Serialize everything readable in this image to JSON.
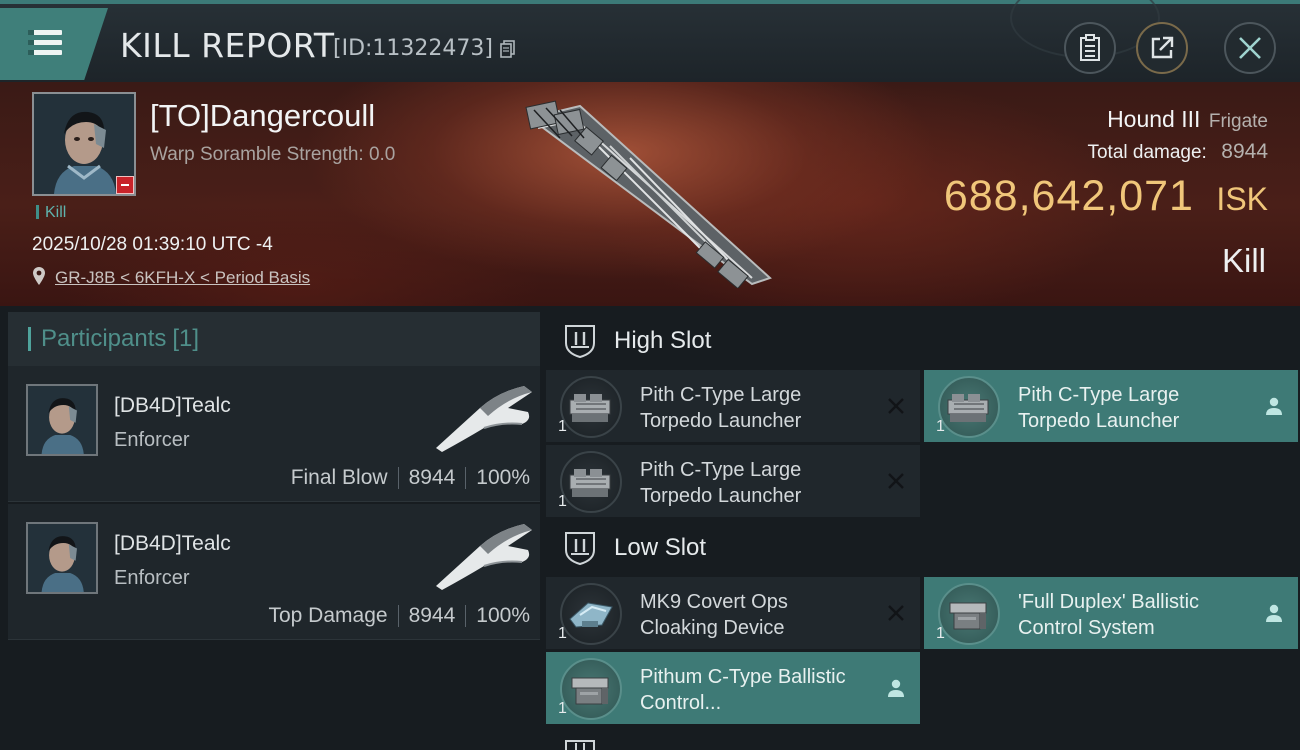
{
  "header": {
    "title": "KILL REPORT",
    "id_label": "[ID:11322473]"
  },
  "victim": {
    "name": "[TO]Dangercoull",
    "scramble": "Warp Soramble Strength: 0.0",
    "tag": "Kill",
    "timestamp": "2025/10/28 01:39:10 UTC -4",
    "location": "GR-J8B < 6KFH-X < Period Basis",
    "ship_name": "Hound III",
    "ship_class": "Frigate",
    "damage_label": "Total damage:",
    "damage_value": "8944",
    "isk_value": "688,642,071",
    "isk_unit": "ISK",
    "result": "Kill"
  },
  "participants": {
    "title": "Participants",
    "count": "[1]",
    "cards": [
      {
        "name": "[DB4D]Tealc",
        "ship": "Enforcer",
        "role": "Final Blow",
        "damage": "8944",
        "percent": "100%"
      },
      {
        "name": "[DB4D]Tealc",
        "ship": "Enforcer",
        "role": "Top Damage",
        "damage": "8944",
        "percent": "100%"
      }
    ]
  },
  "fitting": {
    "high_slot": {
      "title": "High Slot",
      "modules": [
        {
          "name": "Pith C-Type Large Torpedo Launcher",
          "qty": "1",
          "status": "destroyed",
          "icon": "torpedo-launcher-icon"
        },
        {
          "name": "Pith C-Type Large Torpedo Launcher",
          "qty": "1",
          "status": "dropped",
          "icon": "torpedo-launcher-icon"
        },
        {
          "name": "Pith C-Type Large Torpedo Launcher",
          "qty": "1",
          "status": "destroyed",
          "icon": "torpedo-launcher-icon"
        }
      ]
    },
    "low_slot": {
      "title": "Low Slot",
      "modules": [
        {
          "name": "MK9 Covert Ops Cloaking Device",
          "qty": "1",
          "status": "destroyed",
          "icon": "cloaking-device-icon"
        },
        {
          "name": "'Full Duplex' Ballistic Control System",
          "qty": "1",
          "status": "dropped",
          "icon": "ballistic-control-icon"
        },
        {
          "name": "Pithum C-Type Ballistic Control...",
          "qty": "1",
          "status": "dropped",
          "icon": "ballistic-control-icon"
        }
      ]
    }
  },
  "colors": {
    "accent_teal": "#3e7a76",
    "isk_gold": "#f0c67a",
    "minus_red": "#c8232a"
  }
}
